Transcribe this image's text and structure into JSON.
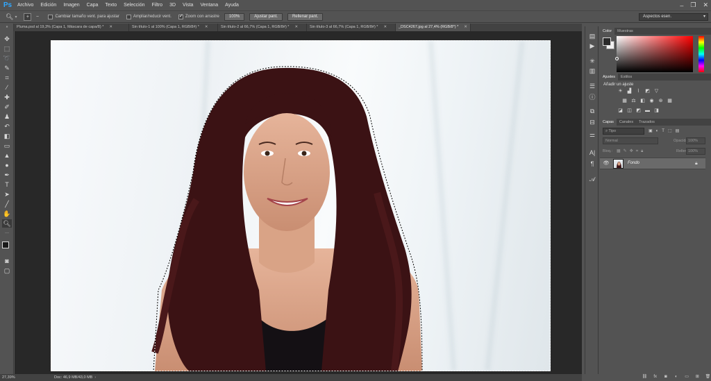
{
  "app": {
    "logo": "Ps"
  },
  "menu": [
    "Archivo",
    "Edición",
    "Imagen",
    "Capa",
    "Texto",
    "Selección",
    "Filtro",
    "3D",
    "Vista",
    "Ventana",
    "Ayuda"
  ],
  "window_controls": [
    "–",
    "❐",
    "✕"
  ],
  "options": {
    "resize_windows_label": "Cambiar tamaño vent. para ajustar",
    "resize_windows_checked": false,
    "zoom_all_label": "Ampliar/reducir vent.",
    "zoom_all_checked": false,
    "scrubby_label": "Zoom con arrastre",
    "scrubby_checked": true,
    "zoom_value": "100%",
    "fit_screen": "Ajustar pant.",
    "fill_screen": "Rellenar pant.",
    "workspace": "Aspectos esen."
  },
  "tabs": [
    {
      "label": "Pluma.psd al 19,3% (Capa 1, Máscara de capa/8) *",
      "active": false
    },
    {
      "label": "Sin título-1 al 100% (Capa 1, RGB/8#) *",
      "active": false
    },
    {
      "label": "Sin título-2 al 66,7% (Capa 1, RGB/8#) *",
      "active": false
    },
    {
      "label": "Sin título-3 al 66,7% (Capa 1, RGB/8#) *",
      "active": false
    },
    {
      "label": "_DSC4267.jpg al 27,4% (RGB/8*) *",
      "active": true
    }
  ],
  "status": {
    "zoom": "27,39%",
    "doc": "Doc: 46,9 MB/43,0 MB"
  },
  "panels": {
    "color_tabs": [
      "Color",
      "Muestras"
    ],
    "adjust_tabs": [
      "Ajustes",
      "Estilos"
    ],
    "adjust_title": "Añadir un ajuste",
    "layers_tabs": [
      "Capas",
      "Canales",
      "Trazados"
    ],
    "filter_placeholder": "Tipo",
    "blend_mode": "Normal",
    "opacity_label": "Opacidad:",
    "opacity_value": "100%",
    "lock_label": "Bloq.:",
    "fill_label": "Relleno:",
    "fill_value": "100%",
    "layer_name": "Fondo"
  },
  "colors": {
    "accent": "#31a8ff",
    "panel": "#535353",
    "dark": "#282828"
  }
}
